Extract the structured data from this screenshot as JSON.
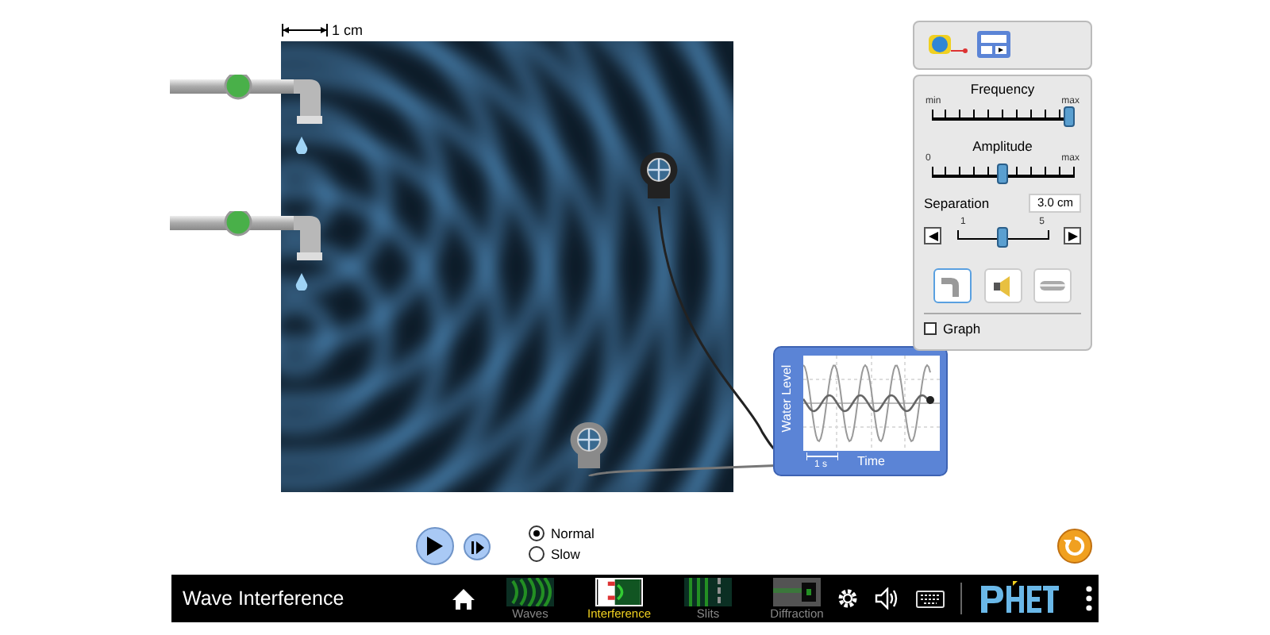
{
  "ruler": {
    "label": "1 cm"
  },
  "controls": {
    "frequency": {
      "title": "Frequency",
      "min_label": "min",
      "max_label": "max",
      "level": 1.0
    },
    "amplitude": {
      "title": "Amplitude",
      "min_label": "0",
      "max_label": "max",
      "level": 0.5
    },
    "separation": {
      "title": "Separation",
      "value": "3.0 cm",
      "min_label": "1",
      "max_label": "5",
      "level": 0.5
    },
    "scene_buttons": [
      {
        "kind": "water",
        "selected": true
      },
      {
        "kind": "sound",
        "selected": false
      },
      {
        "kind": "light",
        "selected": false
      }
    ],
    "graph": {
      "label": "Graph",
      "checked": false
    }
  },
  "graph_panel": {
    "ylabel": "Water Level",
    "xlabel": "Time",
    "scale": "1 s"
  },
  "playback": {
    "speeds": [
      {
        "label": "Normal",
        "selected": true
      },
      {
        "label": "Slow",
        "selected": false
      }
    ]
  },
  "navbar": {
    "title": "Wave Interference",
    "screens": [
      {
        "kind": "waves",
        "label": "Waves",
        "selected": false
      },
      {
        "kind": "interference",
        "label": "Interference",
        "selected": true
      },
      {
        "kind": "slits",
        "label": "Slits",
        "selected": false
      },
      {
        "kind": "diffraction",
        "label": "Diffraction",
        "selected": false
      }
    ]
  }
}
